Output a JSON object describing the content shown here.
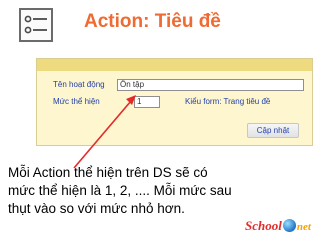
{
  "header": {
    "icon": "list-icon",
    "title": "Action: Tiêu đề"
  },
  "form": {
    "name_label": "Tên hoạt động",
    "name_value": "Ôn tập",
    "level_label": "Mức thể hiện",
    "level_value": "1",
    "form_type_label": "Kiểu form: Trang tiêu đề",
    "update_button": "Cập nhật"
  },
  "description": {
    "lines": [
      "Mỗi Action thể hiện trên DS sẽ có",
      "mức thể hiện là 1, 2, .... Mỗi mức sau",
      "thụt vào so với mức nhỏ hơn."
    ]
  },
  "logo": {
    "part1": "School",
    "part2": "net"
  },
  "colors": {
    "title": "#ee6b33",
    "label": "#2440a8",
    "panel_bg": "#fdf6cf",
    "panel_strip": "#efdb7f",
    "arrow": "#e32b2b"
  }
}
